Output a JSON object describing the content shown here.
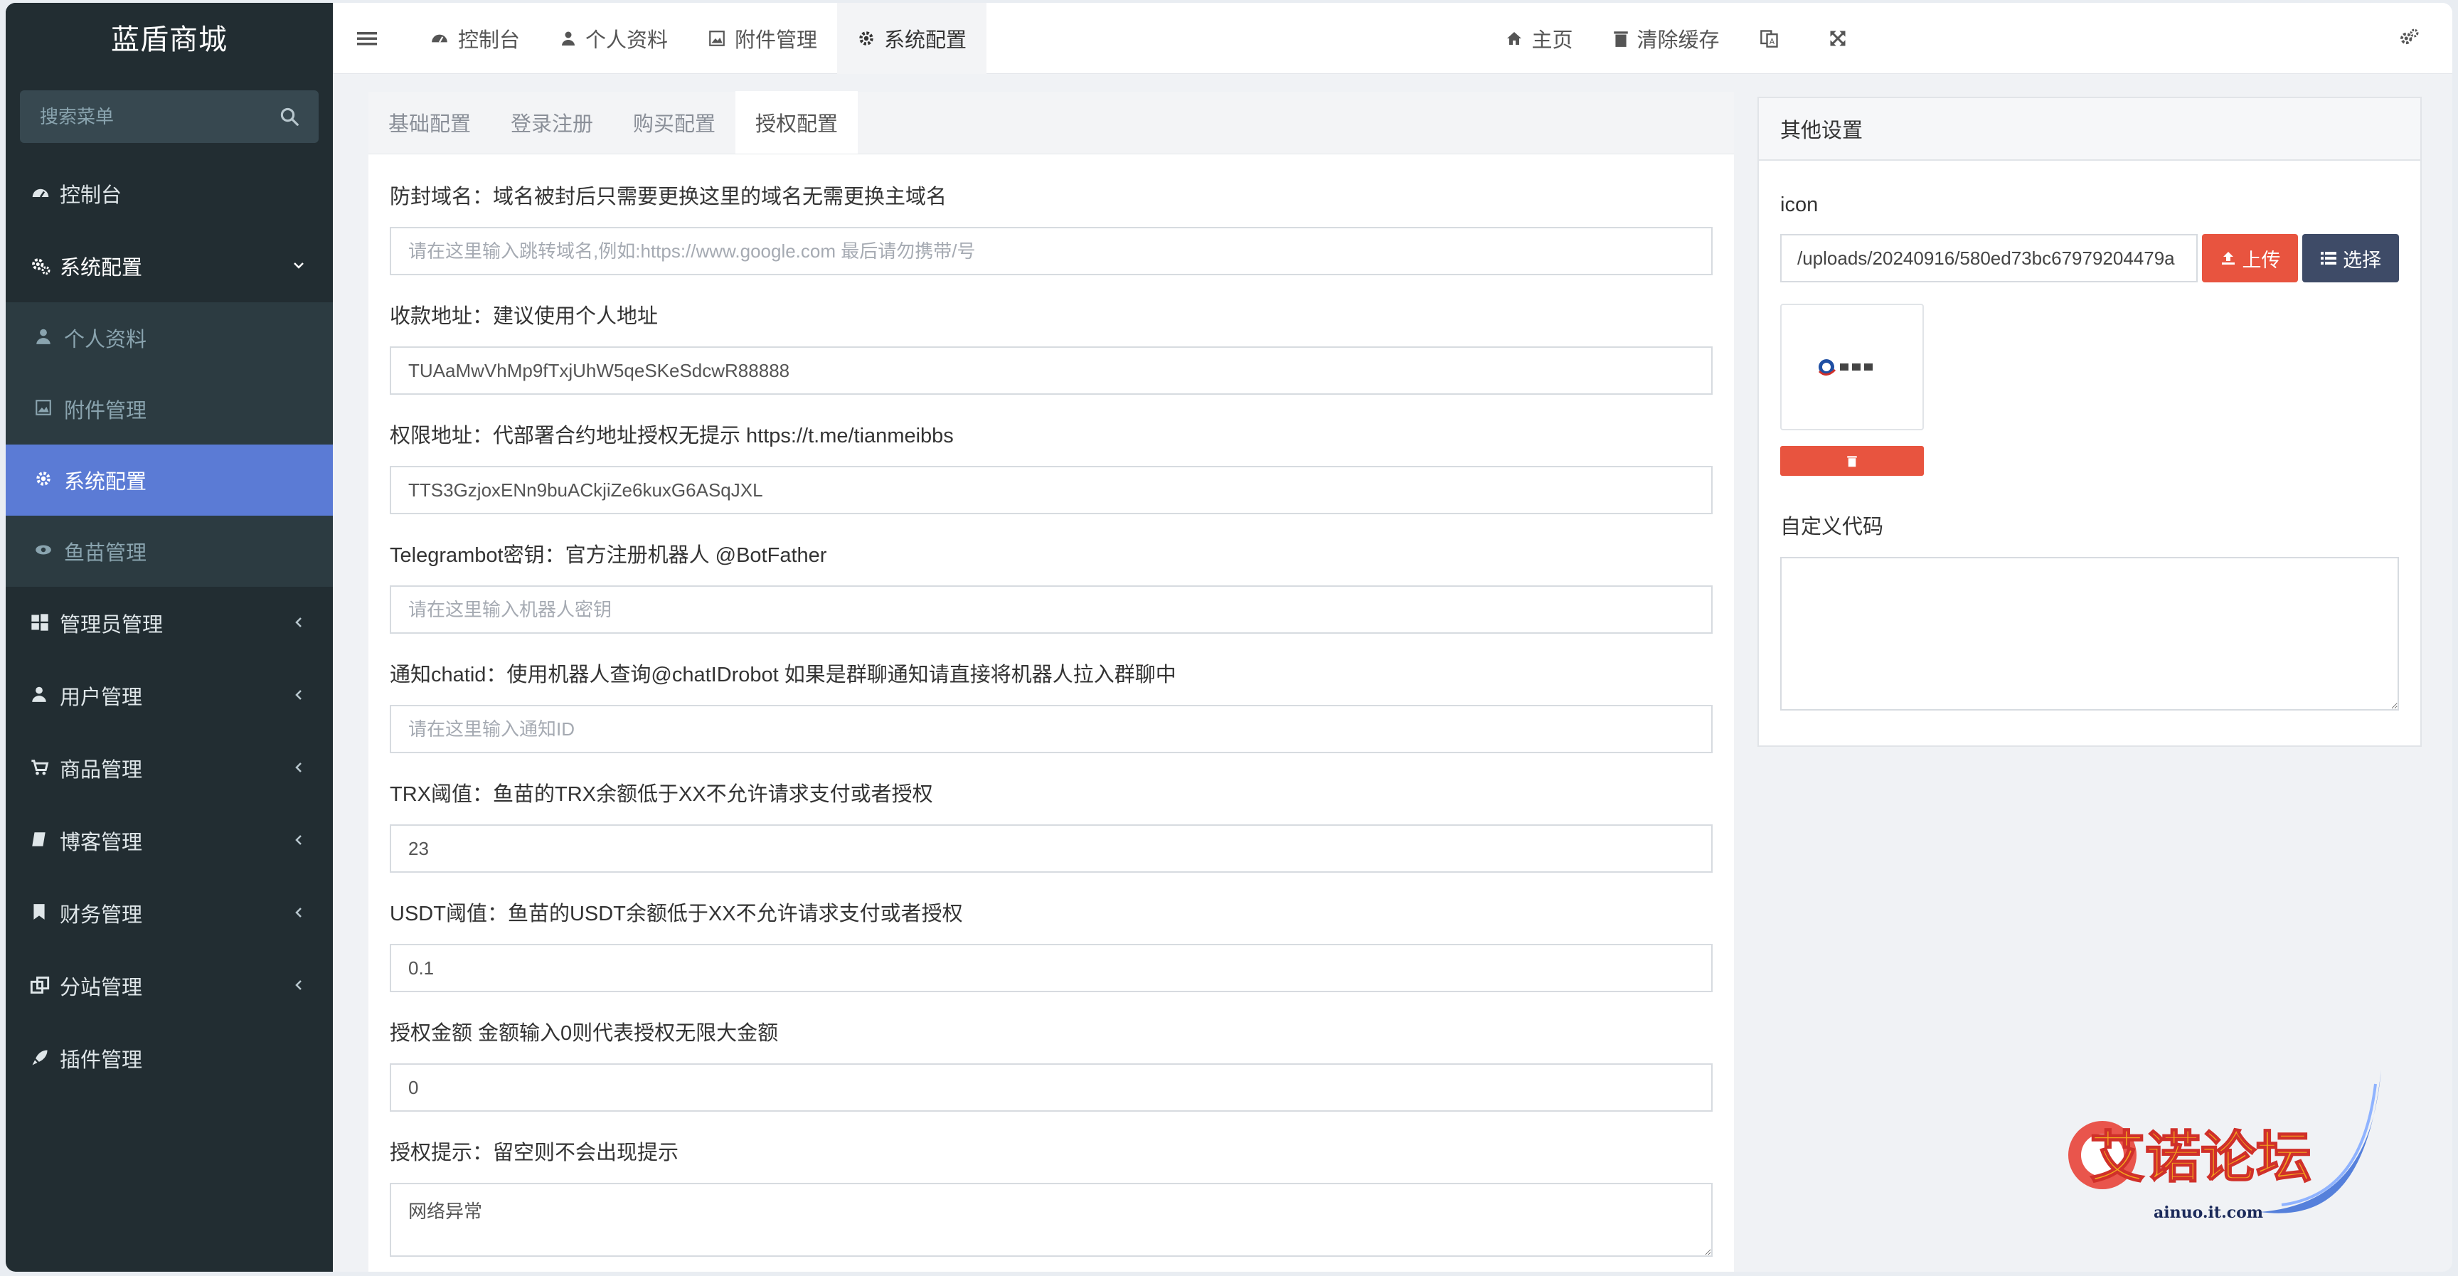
{
  "sidebar": {
    "brand": "蓝盾商城",
    "search_placeholder": "搜索菜单",
    "items": [
      {
        "label": "控制台",
        "icon": "dashboard-icon"
      },
      {
        "label": "系统配置",
        "icon": "cogs-icon",
        "open": true
      },
      {
        "label": "管理员管理",
        "icon": "windows-icon"
      },
      {
        "label": "用户管理",
        "icon": "user-icon"
      },
      {
        "label": "商品管理",
        "icon": "cart-icon"
      },
      {
        "label": "博客管理",
        "icon": "book-icon"
      },
      {
        "label": "财务管理",
        "icon": "bookmark-icon"
      },
      {
        "label": "分站管理",
        "icon": "clone-icon"
      },
      {
        "label": "插件管理",
        "icon": "rocket-icon"
      }
    ],
    "submenu": [
      {
        "label": "个人资料",
        "icon": "user-icon"
      },
      {
        "label": "附件管理",
        "icon": "image-icon"
      },
      {
        "label": "系统配置",
        "icon": "gear-icon",
        "active": true
      },
      {
        "label": "鱼苗管理",
        "icon": "eye-icon"
      }
    ]
  },
  "topbar": {
    "tabs": [
      {
        "label": "控制台",
        "icon": "dashboard-icon"
      },
      {
        "label": "个人资料",
        "icon": "user-icon"
      },
      {
        "label": "附件管理",
        "icon": "image-icon"
      },
      {
        "label": "系统配置",
        "icon": "gear-icon",
        "active": true
      }
    ],
    "home": "主页",
    "clear_cache": "清除缓存"
  },
  "config_tabs": [
    "基础配置",
    "登录注册",
    "购买配置",
    "授权配置"
  ],
  "active_config_tab": "授权配置",
  "form": [
    {
      "label": "防封域名：域名被封后只需要更换这里的域名无需更换主域名",
      "value": "",
      "placeholder": "请在这里输入跳转域名,例如:https://www.google.com 最后请勿携带/号"
    },
    {
      "label": "收款地址：建议使用个人地址",
      "value": "TUAaMwVhMp9fTxjUhW5qeSKeSdcwR88888",
      "placeholder": ""
    },
    {
      "label": "权限地址：代部署合约地址授权无提示 https://t.me/tianmeibbs",
      "value": "TTS3GzjoxENn9buACkjiZe6kuxG6ASqJXL",
      "placeholder": ""
    },
    {
      "label": "Telegrambot密钥：官方注册机器人 @BotFather",
      "value": "",
      "placeholder": "请在这里输入机器人密钥"
    },
    {
      "label": "通知chatid：使用机器人查询@chatIDrobot 如果是群聊通知请直接将机器人拉入群聊中",
      "value": "",
      "placeholder": "请在这里输入通知ID"
    },
    {
      "label": "TRX阈值：鱼苗的TRX余额低于XX不允许请求支付或者授权",
      "value": "23",
      "placeholder": ""
    },
    {
      "label": "USDT阈值：鱼苗的USDT余额低于XX不允许请求支付或者授权",
      "value": "0.1",
      "placeholder": ""
    },
    {
      "label": "授权金额 金额输入0则代表授权无限大金额",
      "value": "0",
      "placeholder": ""
    },
    {
      "label": "授权提示：留空则不会出现提示",
      "value": "网络异常",
      "placeholder": ""
    }
  ],
  "other": {
    "title": "其他设置",
    "icon_label": "icon",
    "icon_value": "/uploads/20240916/580ed73bc67979204479a",
    "upload_label": "上传",
    "choose_label": "选择",
    "custom_code_label": "自定义代码",
    "custom_code_value": ""
  },
  "watermark": {
    "text": "艾诺论坛",
    "url": "ainuo.it.com"
  },
  "colors": {
    "sidebar_bg": "#222d32",
    "active": "#5b7bd5",
    "danger": "#e8543f",
    "dark_btn": "#3e4b67"
  }
}
